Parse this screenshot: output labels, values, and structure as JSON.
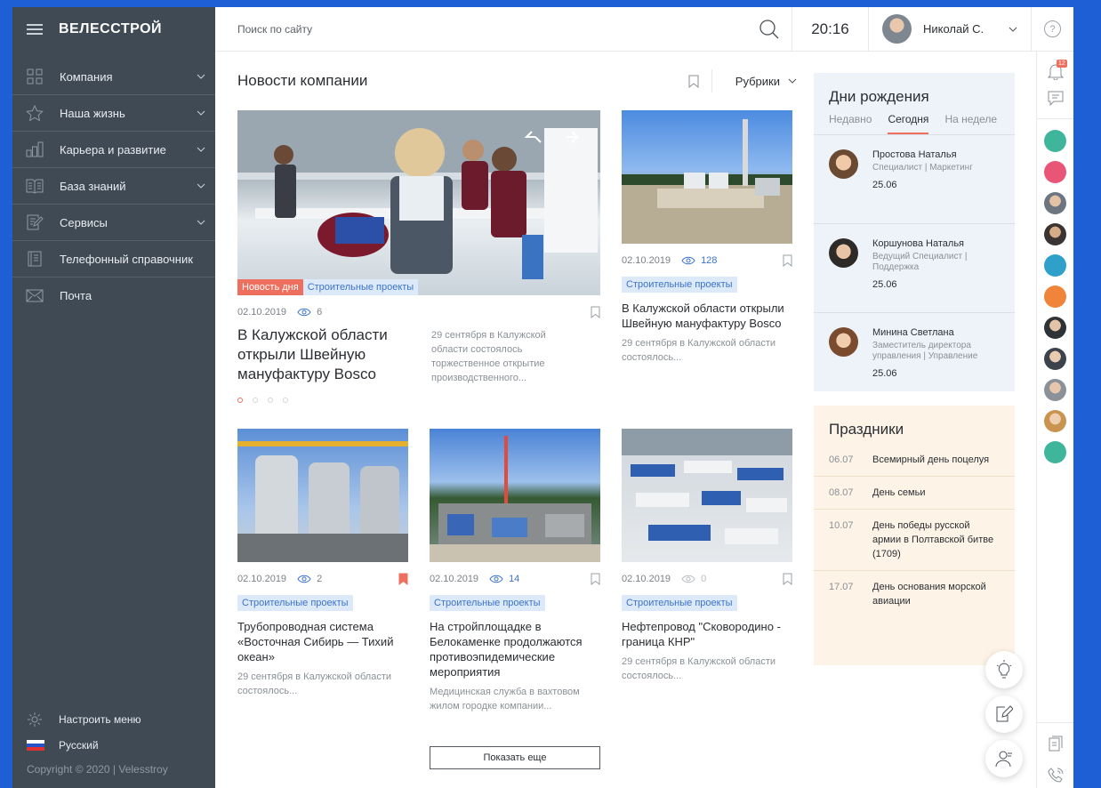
{
  "sidebar": {
    "logo": "ВЕЛЕССТРОЙ",
    "items": [
      {
        "label": "Компания",
        "icon": "grid-icon",
        "chevron": true
      },
      {
        "label": "Наша жизнь",
        "icon": "star-icon",
        "chevron": true
      },
      {
        "label": "Карьера и развитие",
        "icon": "bar-chart-icon",
        "chevron": true
      },
      {
        "label": "База знаний",
        "icon": "book-icon",
        "chevron": true
      },
      {
        "label": "Сервисы",
        "icon": "edit-doc-icon",
        "chevron": true
      },
      {
        "label": "Телефонный справочник",
        "icon": "phonebook-icon",
        "chevron": false
      },
      {
        "label": "Почта",
        "icon": "mail-icon",
        "chevron": false
      }
    ],
    "customize_label": "Настроить меню",
    "language_label": "Русский",
    "copyright": "Copyright © 2020  |  Velesstroy"
  },
  "topbar": {
    "search_placeholder": "Поиск по сайту",
    "time": "20:16",
    "user_name": "Николай С."
  },
  "news": {
    "title": "Новости компании",
    "rubrics_label": "Рубрики",
    "featured": {
      "tag_day": "Новость дня",
      "tag": "Строительные проекты",
      "date": "02.10.2019",
      "views": "6",
      "title": "В Калужской области открыли Швейную мануфактуру Bosco",
      "desc": "29 сентября в Калужской области состоялось торжественное открытие производственного..."
    },
    "side": {
      "date": "02.10.2019",
      "views": "128",
      "tag": "Строительные проекты",
      "title": "В Калужской области открыли Швейную мануфактуру Bosco",
      "desc": "29 сентября в Калужской области состоялось..."
    },
    "cards": [
      {
        "date": "02.10.2019",
        "views": "2",
        "tag": "Строительные проекты",
        "title": "Трубопроводная система «Восточная Сибирь — Тихий океан»",
        "desc": "29 сентября в Калужской области состоялось...",
        "bookmarked": true
      },
      {
        "date": "02.10.2019",
        "views": "14",
        "tag": "Строительные проекты",
        "title": "На стройплощадке в Белокаменке продолжаются противоэпидемические мероприятия",
        "desc": "Медицинская служба в вахтовом жилом городке компании...",
        "bookmarked": false
      },
      {
        "date": "02.10.2019",
        "views": "0",
        "tag": "Строительные проекты",
        "title": "Нефтепровод \"Сковородино - граница КНР\"",
        "desc": "29 сентября в Калужской области состоялось...",
        "bookmarked": false
      }
    ],
    "show_more": "Показать еще"
  },
  "birthdays": {
    "title": "Дни рождения",
    "tabs": [
      "Недавно",
      "Сегодня",
      "На неделе"
    ],
    "people": [
      {
        "name": "Простова Наталья",
        "position": "Специалист  |  Маркетинг",
        "date": "25.06"
      },
      {
        "name": "Коршунова Наталья",
        "position": "Ведущий Специалист  |  Поддержка",
        "date": "25.06"
      },
      {
        "name": "Минина Светлана",
        "position": "Заместитель директора управления  |  Управление",
        "date": "25.06"
      }
    ]
  },
  "holidays": {
    "title": "Праздники",
    "items": [
      {
        "date": "06.07",
        "name": "Всемирный день поцелуя"
      },
      {
        "date": "08.07",
        "name": "День семьи"
      },
      {
        "date": "10.07",
        "name": "День победы русской армии в Полтавской битве (1709)"
      },
      {
        "date": "17.07",
        "name": "День основания морской авиации"
      }
    ]
  },
  "rail": {
    "notifications_count": "12"
  },
  "colors": {
    "accent": "#ef6f5e",
    "sidebar": "#3f4a55",
    "tag_bg": "#dce9f8",
    "tag_text": "#3c73c9",
    "teal_avatar": "#3fb59c",
    "pink_avatar": "#e85577",
    "orange_avatar": "#f1843b"
  }
}
